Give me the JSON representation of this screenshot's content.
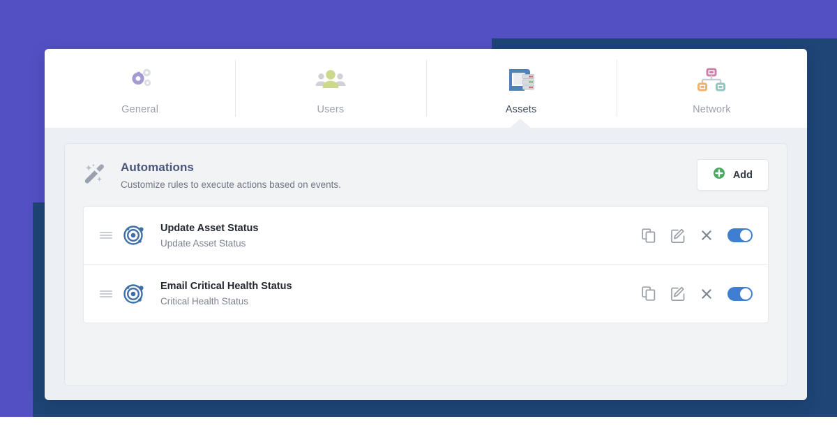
{
  "theme": {
    "backdrop_purple": "#5350c4",
    "backdrop_navy": "#1e4575",
    "panel_bg": "#eceff3",
    "accent_blue": "#3f7fd1",
    "accent_green": "#4ca963",
    "title_color": "#4a5678"
  },
  "tabs": [
    {
      "label": "General",
      "icon": "gears-icon",
      "active": false
    },
    {
      "label": "Users",
      "icon": "users-icon",
      "active": false
    },
    {
      "label": "Assets",
      "icon": "assets-server-icon",
      "active": true
    },
    {
      "label": "Network",
      "icon": "network-topology-icon",
      "active": false
    }
  ],
  "section": {
    "icon": "magic-wand-icon",
    "title": "Automations",
    "subtitle": "Customize rules to execute actions based on events.",
    "add_button": {
      "label": "Add",
      "icon": "plus-circle-icon"
    }
  },
  "rules": [
    {
      "icon": "target-radar-icon",
      "title": "Update Asset Status",
      "subtitle": "Update Asset Status",
      "actions": {
        "copy": "copy-icon",
        "edit": "edit-pencil-icon",
        "delete": "close-x-icon"
      },
      "enabled": true
    },
    {
      "icon": "target-radar-icon",
      "title": "Email Critical Health Status",
      "subtitle": "Critical Health Status",
      "actions": {
        "copy": "copy-icon",
        "edit": "edit-pencil-icon",
        "delete": "close-x-icon"
      },
      "enabled": true
    }
  ]
}
